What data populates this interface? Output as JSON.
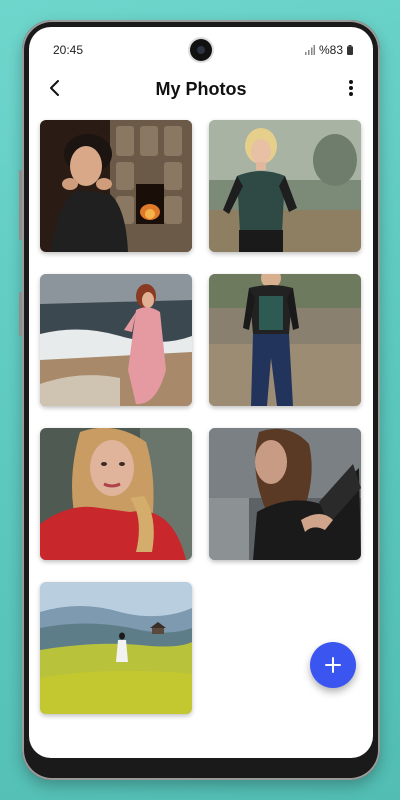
{
  "status_bar": {
    "time": "20:45",
    "battery": "%83"
  },
  "app_bar": {
    "title": "My Photos"
  },
  "photos": [
    {
      "subject": "woman-resting-chin-by-fireplace"
    },
    {
      "subject": "blonde-woman-in-field"
    },
    {
      "subject": "woman-in-pink-dress-on-beach"
    },
    {
      "subject": "woman-in-jeans-standing"
    },
    {
      "subject": "woman-in-red-sweater"
    },
    {
      "subject": "woman-in-black-profile"
    },
    {
      "subject": "woman-in-rice-field"
    }
  ],
  "fab": {
    "icon": "plus-icon",
    "color": "#3a55f0"
  },
  "colors": {
    "background": "#5ccabf",
    "accent": "#3a55f0"
  }
}
